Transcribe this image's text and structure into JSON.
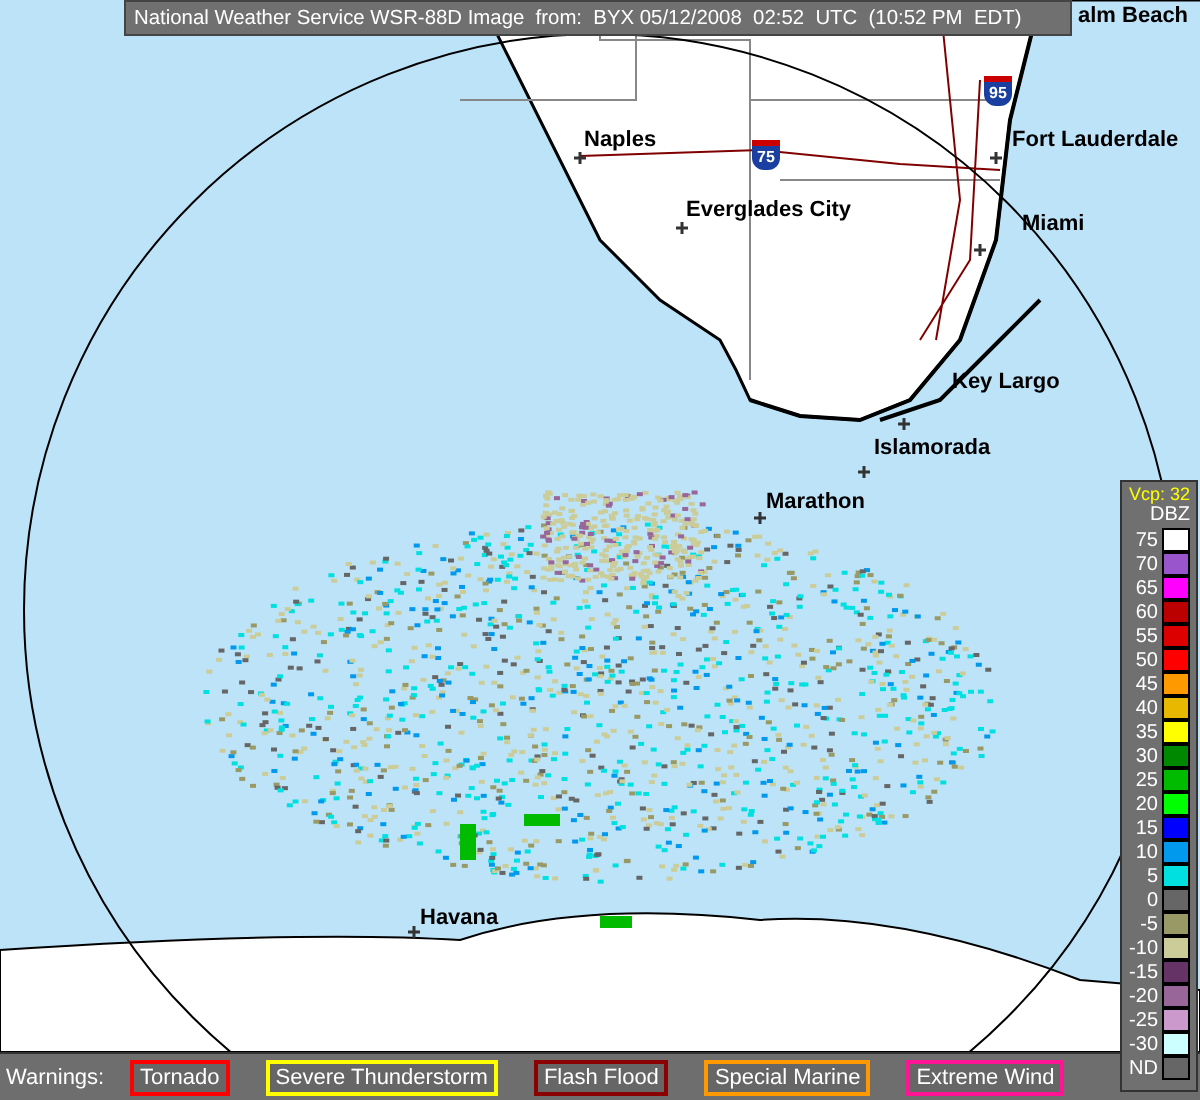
{
  "title": "National Weather Service WSR-88D Image  from:  BYX 05/12/2008  02:52  UTC  (10:52 PM  EDT)",
  "map": {
    "cities": [
      "alm Beach",
      "Naples",
      "Fort Lauderdale",
      "Everglades City",
      "Miami",
      "Key Largo",
      "Islamorada",
      "Marathon",
      "Havana"
    ],
    "highway_shields": [
      "95",
      "75"
    ]
  },
  "legend": {
    "vcp": "Vcp: 32",
    "unit": "DBZ",
    "levels": [
      {
        "label": "75",
        "color": "#ffffff"
      },
      {
        "label": "70",
        "color": "#9955cc"
      },
      {
        "label": "65",
        "color": "#ff00ff"
      },
      {
        "label": "60",
        "color": "#bb0000"
      },
      {
        "label": "55",
        "color": "#dd0000"
      },
      {
        "label": "50",
        "color": "#ff0000"
      },
      {
        "label": "45",
        "color": "#ff9900"
      },
      {
        "label": "40",
        "color": "#e8b800"
      },
      {
        "label": "35",
        "color": "#ffff00"
      },
      {
        "label": "30",
        "color": "#008800"
      },
      {
        "label": "25",
        "color": "#00bb00"
      },
      {
        "label": "20",
        "color": "#00ff00"
      },
      {
        "label": "15",
        "color": "#0000ff"
      },
      {
        "label": "10",
        "color": "#0099ee"
      },
      {
        "label": "5",
        "color": "#00e0e0"
      },
      {
        "label": "0",
        "color": "#666666"
      },
      {
        "label": "-5",
        "color": "#999966"
      },
      {
        "label": "-10",
        "color": "#cccc99"
      },
      {
        "label": "-15",
        "color": "#663366"
      },
      {
        "label": "-20",
        "color": "#996699"
      },
      {
        "label": "-25",
        "color": "#cc99cc"
      },
      {
        "label": "-30",
        "color": "#ccffff"
      },
      {
        "label": "ND",
        "color": "#666666"
      }
    ]
  },
  "warnings": {
    "label": "Warnings:",
    "items": [
      {
        "label": "Tornado",
        "color": "#ff0000"
      },
      {
        "label": "Severe Thunderstorm",
        "color": "#ffff00"
      },
      {
        "label": "Flash Flood",
        "color": "#8b0000"
      },
      {
        "label": "Special Marine",
        "color": "#ff9900"
      },
      {
        "label": "Extreme Wind",
        "color": "#ff1493"
      }
    ]
  }
}
